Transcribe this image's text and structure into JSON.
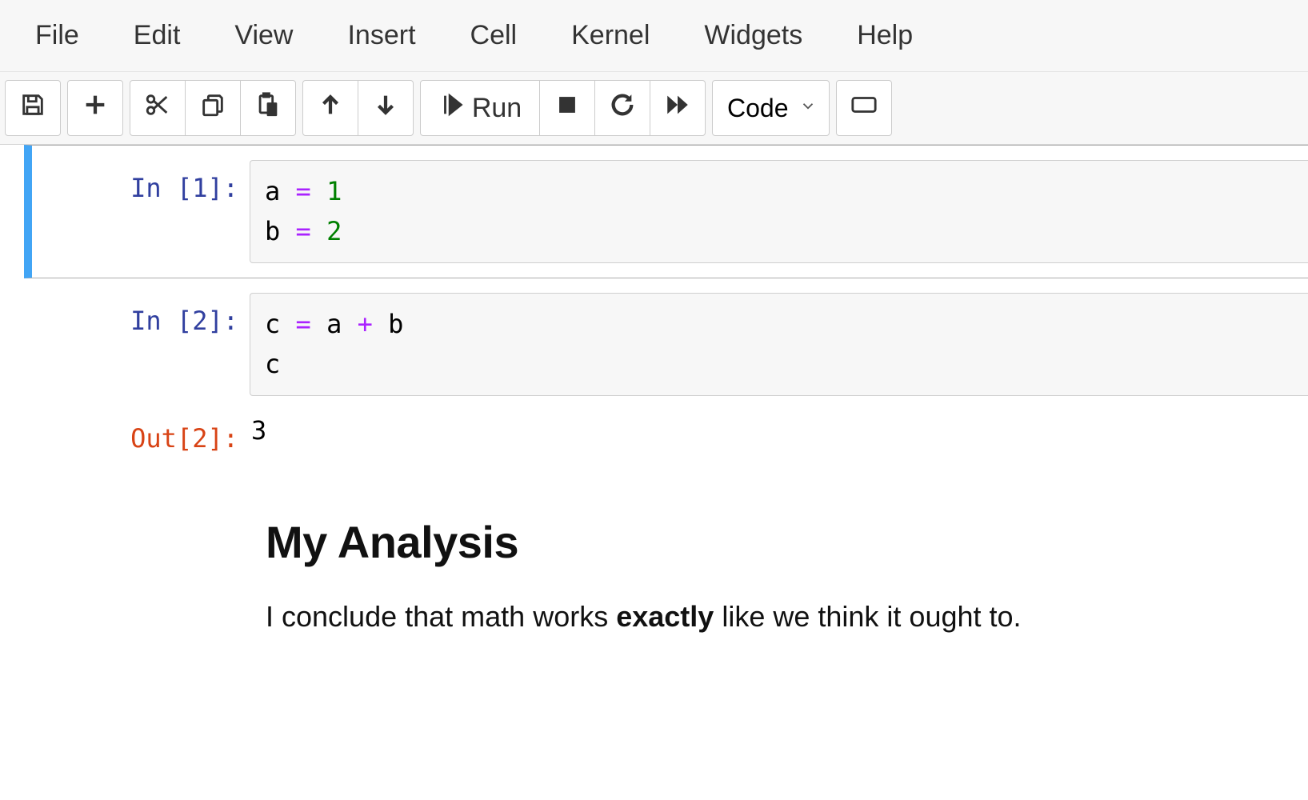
{
  "menu": {
    "items": [
      "File",
      "Edit",
      "View",
      "Insert",
      "Cell",
      "Kernel",
      "Widgets",
      "Help"
    ]
  },
  "toolbar": {
    "run_label": "Run",
    "cell_type_selected": "Code"
  },
  "cells": [
    {
      "type": "code",
      "selected": true,
      "in_prompt": "In [1]:",
      "source": [
        {
          "tokens": [
            {
              "t": "nm",
              "v": "a"
            },
            {
              "t": "sp",
              "v": " "
            },
            {
              "t": "op",
              "v": "="
            },
            {
              "t": "sp",
              "v": " "
            },
            {
              "t": "num",
              "v": "1"
            }
          ]
        },
        {
          "tokens": [
            {
              "t": "nm",
              "v": "b"
            },
            {
              "t": "sp",
              "v": " "
            },
            {
              "t": "op",
              "v": "="
            },
            {
              "t": "sp",
              "v": " "
            },
            {
              "t": "num",
              "v": "2"
            }
          ]
        }
      ]
    },
    {
      "type": "code",
      "selected": false,
      "in_prompt": "In [2]:",
      "source": [
        {
          "tokens": [
            {
              "t": "nm",
              "v": "c"
            },
            {
              "t": "sp",
              "v": " "
            },
            {
              "t": "op",
              "v": "="
            },
            {
              "t": "sp",
              "v": " "
            },
            {
              "t": "nm",
              "v": "a"
            },
            {
              "t": "sp",
              "v": " "
            },
            {
              "t": "op",
              "v": "+"
            },
            {
              "t": "sp",
              "v": " "
            },
            {
              "t": "nm",
              "v": "b"
            }
          ]
        },
        {
          "tokens": [
            {
              "t": "nm",
              "v": "c"
            }
          ]
        }
      ],
      "out_prompt": "Out[2]:",
      "output": "3"
    },
    {
      "type": "markdown",
      "heading": "My Analysis",
      "paragraph_parts": [
        {
          "t": "text",
          "v": "I conclude that math works "
        },
        {
          "t": "strong",
          "v": "exactly"
        },
        {
          "t": "text",
          "v": " like we think it ought to."
        }
      ]
    }
  ]
}
